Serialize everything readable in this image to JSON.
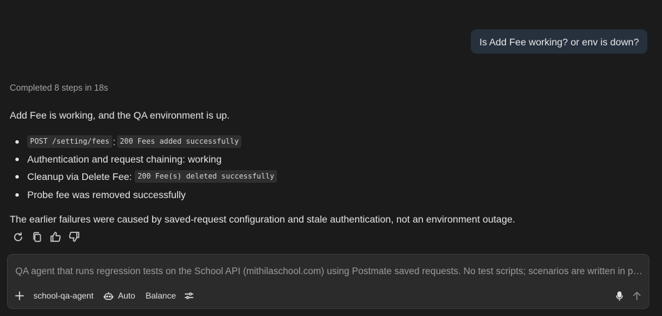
{
  "conversation": {
    "user_message": "Is Add Fee working? or env is down?",
    "steps_summary": "Completed 8 steps in 18s",
    "answer_intro": "Add Fee is working, and the QA environment is up.",
    "bullets": [
      {
        "code": "POST /setting/fees",
        "separator": ":",
        "code2": "200 Fees added successfully"
      },
      {
        "text": "Authentication and request chaining: working"
      },
      {
        "text": "Cleanup via Delete Fee:",
        "code": "200 Fee(s) deleted successfully"
      },
      {
        "text": "Probe fee was removed successfully"
      }
    ],
    "summary": "The earlier failures were caused by saved-request configuration and stale authentication, not an environment outage."
  },
  "actions": {
    "icons": [
      "retry-icon",
      "copy-icon",
      "thumbs-up-icon",
      "thumbs-down-icon"
    ]
  },
  "composer": {
    "placeholder": "QA agent that runs regression tests on the School API (mithilaschool.com) using Postmate saved requests. No test scripts; scenarios are written in plain English.",
    "agent_label": "school-qa-agent",
    "mode_label": "Auto",
    "profile_label": "Balance",
    "icons": [
      "plus-icon",
      "robot-icon",
      "sliders-icon",
      "microphone-icon",
      "send-arrow-icon"
    ]
  },
  "colors": {
    "background": "#1b1b1b",
    "user_bubble": "#27303d",
    "composer_bg": "#2b2b2b",
    "code_bg": "#2f2f2f",
    "muted_text": "#a3a3a3"
  }
}
